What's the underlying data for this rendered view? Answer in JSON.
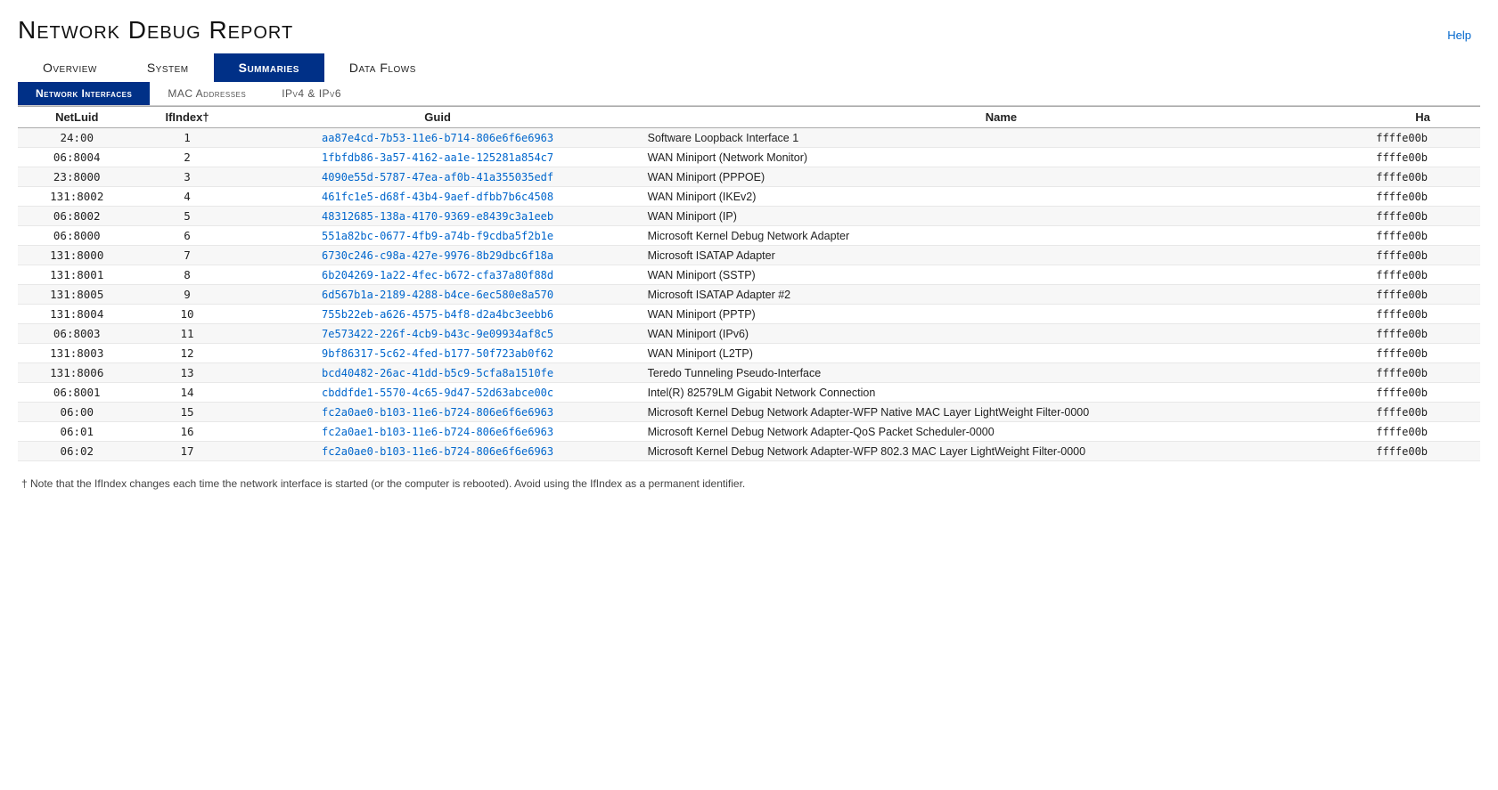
{
  "page": {
    "title": "Network Debug Report",
    "help_label": "Help"
  },
  "main_tabs": [
    {
      "label": "Overview",
      "active": false
    },
    {
      "label": "System",
      "active": false
    },
    {
      "label": "Summaries",
      "active": true
    },
    {
      "label": "Data Flows",
      "active": false
    }
  ],
  "sub_tabs": [
    {
      "label": "Network Interfaces",
      "active": true
    },
    {
      "label": "MAC Addresses",
      "active": false
    },
    {
      "label": "IPv4 & IPv6",
      "active": false
    }
  ],
  "table": {
    "columns": [
      "NetLuid",
      "IfIndex†",
      "Guid",
      "Name",
      "Ha"
    ],
    "rows": [
      {
        "netluid": "24:00",
        "ifindex": "1",
        "guid": "aa87e4cd-7b53-11e6-b714-806e6f6e6963",
        "name": "Software Loopback Interface 1",
        "ha": "ffffe00b"
      },
      {
        "netluid": "06:8004",
        "ifindex": "2",
        "guid": "1fbfdb86-3a57-4162-aa1e-125281a854c7",
        "name": "WAN Miniport (Network Monitor)",
        "ha": "ffffe00b"
      },
      {
        "netluid": "23:8000",
        "ifindex": "3",
        "guid": "4090e55d-5787-47ea-af0b-41a355035edf",
        "name": "WAN Miniport (PPPOE)",
        "ha": "ffffe00b"
      },
      {
        "netluid": "131:8002",
        "ifindex": "4",
        "guid": "461fc1e5-d68f-43b4-9aef-dfbb7b6c4508",
        "name": "WAN Miniport (IKEv2)",
        "ha": "ffffe00b"
      },
      {
        "netluid": "06:8002",
        "ifindex": "5",
        "guid": "48312685-138a-4170-9369-e8439c3a1eeb",
        "name": "WAN Miniport (IP)",
        "ha": "ffffe00b"
      },
      {
        "netluid": "06:8000",
        "ifindex": "6",
        "guid": "551a82bc-0677-4fb9-a74b-f9cdba5f2b1e",
        "name": "Microsoft Kernel Debug Network Adapter",
        "ha": "ffffe00b"
      },
      {
        "netluid": "131:8000",
        "ifindex": "7",
        "guid": "6730c246-c98a-427e-9976-8b29dbc6f18a",
        "name": "Microsoft ISATAP Adapter",
        "ha": "ffffe00b"
      },
      {
        "netluid": "131:8001",
        "ifindex": "8",
        "guid": "6b204269-1a22-4fec-b672-cfa37a80f88d",
        "name": "WAN Miniport (SSTP)",
        "ha": "ffffe00b"
      },
      {
        "netluid": "131:8005",
        "ifindex": "9",
        "guid": "6d567b1a-2189-4288-b4ce-6ec580e8a570",
        "name": "Microsoft ISATAP Adapter #2",
        "ha": "ffffe00b"
      },
      {
        "netluid": "131:8004",
        "ifindex": "10",
        "guid": "755b22eb-a626-4575-b4f8-d2a4bc3eebb6",
        "name": "WAN Miniport (PPTP)",
        "ha": "ffffe00b"
      },
      {
        "netluid": "06:8003",
        "ifindex": "11",
        "guid": "7e573422-226f-4cb9-b43c-9e09934af8c5",
        "name": "WAN Miniport (IPv6)",
        "ha": "ffffe00b"
      },
      {
        "netluid": "131:8003",
        "ifindex": "12",
        "guid": "9bf86317-5c62-4fed-b177-50f723ab0f62",
        "name": "WAN Miniport (L2TP)",
        "ha": "ffffe00b"
      },
      {
        "netluid": "131:8006",
        "ifindex": "13",
        "guid": "bcd40482-26ac-41dd-b5c9-5cfa8a1510fe",
        "name": "Teredo Tunneling Pseudo-Interface",
        "ha": "ffffe00b"
      },
      {
        "netluid": "06:8001",
        "ifindex": "14",
        "guid": "cbddfde1-5570-4c65-9d47-52d63abce00c",
        "name": "Intel(R) 82579LM Gigabit Network Connection",
        "ha": "ffffe00b"
      },
      {
        "netluid": "06:00",
        "ifindex": "15",
        "guid": "fc2a0ae0-b103-11e6-b724-806e6f6e6963",
        "name": "Microsoft Kernel Debug Network Adapter-WFP Native MAC Layer LightWeight Filter-0000",
        "ha": "ffffe00b"
      },
      {
        "netluid": "06:01",
        "ifindex": "16",
        "guid": "fc2a0ae1-b103-11e6-b724-806e6f6e6963",
        "name": "Microsoft Kernel Debug Network Adapter-QoS Packet Scheduler-0000",
        "ha": "ffffe00b"
      },
      {
        "netluid": "06:02",
        "ifindex": "17",
        "guid": "fc2a0ae0-b103-11e6-b724-806e6f6e6963",
        "name": "Microsoft Kernel Debug Network Adapter-WFP 802.3 MAC Layer LightWeight Filter-0000",
        "ha": "ffffe00b"
      }
    ]
  },
  "footnote": "† Note that the IfIndex changes each time the network interface is started (or the computer is rebooted). Avoid using the IfIndex as a permanent identifier."
}
